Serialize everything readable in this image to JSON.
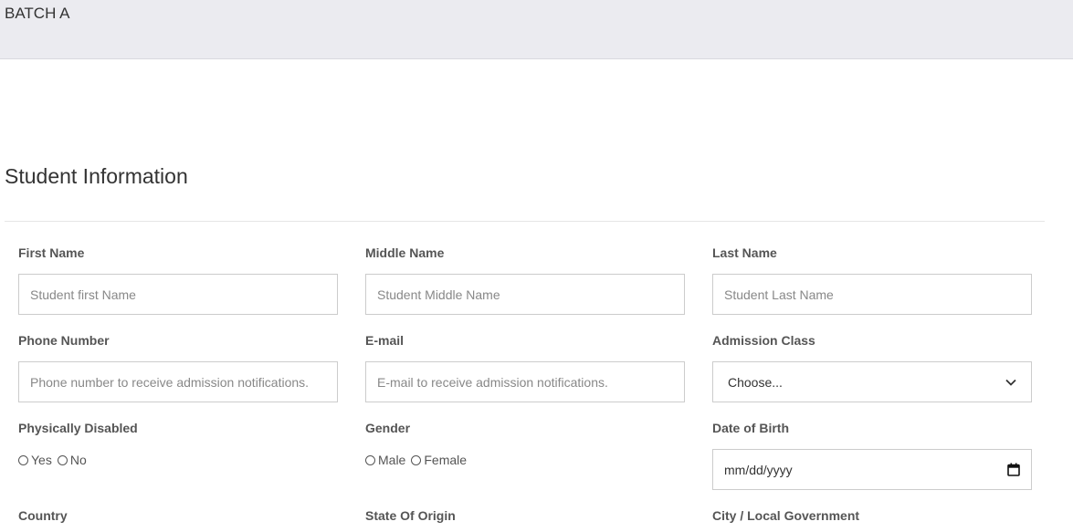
{
  "header": {
    "title": "BATCH A"
  },
  "section": {
    "title": "Student Information"
  },
  "form": {
    "first_name": {
      "label": "First Name",
      "placeholder": "Student first Name"
    },
    "middle_name": {
      "label": "Middle Name",
      "placeholder": "Student Middle Name"
    },
    "last_name": {
      "label": "Last Name",
      "placeholder": "Student Last Name"
    },
    "phone": {
      "label": "Phone Number",
      "placeholder": "Phone number to receive admission notifications."
    },
    "email": {
      "label": "E-mail",
      "placeholder": "E-mail to receive admission notifications."
    },
    "admission_class": {
      "label": "Admission Class",
      "selected": "Choose..."
    },
    "physically_disabled": {
      "label": "Physically Disabled",
      "options": [
        "Yes",
        "No"
      ]
    },
    "gender": {
      "label": "Gender",
      "options": [
        "Male",
        "Female"
      ]
    },
    "dob": {
      "label": "Date of Birth",
      "value": "mm/dd/yyyy"
    },
    "country": {
      "label": "Country"
    },
    "state_of_origin": {
      "label": "State Of Origin"
    },
    "city": {
      "label": "City / Local Government"
    }
  },
  "icons": {
    "select_arrow": "chevron-down-icon",
    "date_picker": "calendar-icon"
  }
}
